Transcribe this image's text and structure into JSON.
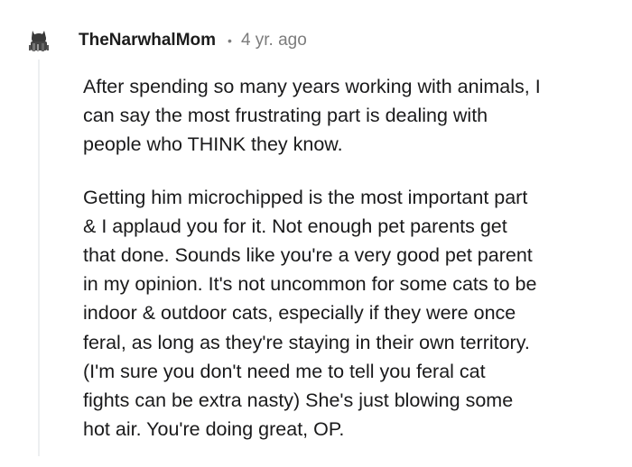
{
  "comment": {
    "username": "TheNarwhalMom",
    "separator": "•",
    "timestamp": "4 yr. ago",
    "avatar_icon": "cat-avatar-icon",
    "paragraphs": [
      [
        "After spending so many years working with animals, I",
        "can say the most frustrating part is dealing with",
        "people who THINK they know."
      ],
      [
        "Getting him microchipped is the most important part",
        "& I applaud you for it. Not enough pet parents get",
        "that done. Sounds like you're a very good pet parent",
        "in my opinion. It's not uncommon for some cats to be",
        "indoor & outdoor cats, especially if they were once",
        "feral, as long as they're staying in their own territory.",
        "(I'm sure you don't need me to tell you feral cat",
        "fights can be extra nasty) She's just blowing some",
        "hot air. You're doing great, OP."
      ]
    ]
  },
  "colors": {
    "text": "#1a1a1b",
    "meta": "#7c7c7c",
    "thread_line": "#edeff1"
  }
}
